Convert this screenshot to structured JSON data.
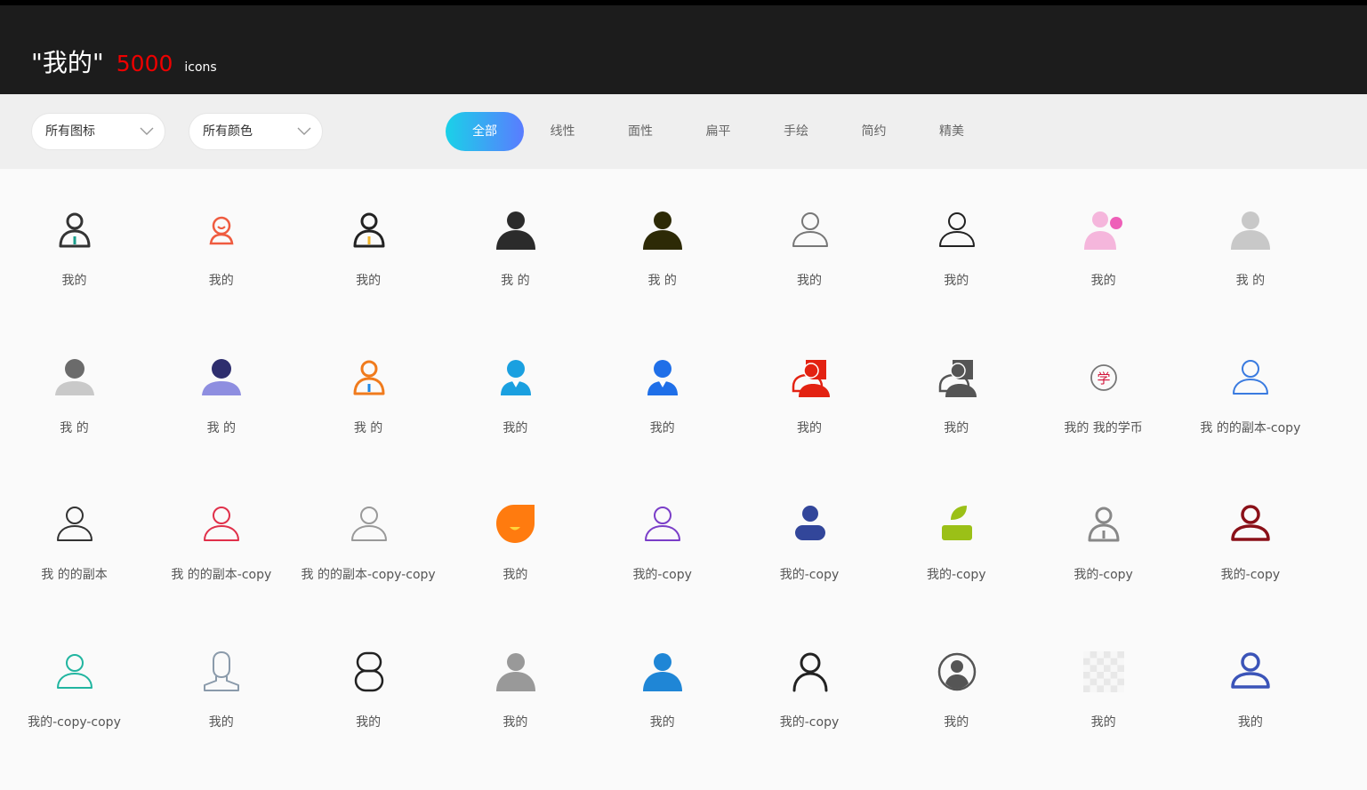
{
  "header": {
    "query": "\"我的\"",
    "count": "5000",
    "unit": "icons"
  },
  "filters": {
    "icon_select": "所有图标",
    "color_select": "所有颜色"
  },
  "tabs": [
    {
      "label": "全部",
      "active": true
    },
    {
      "label": "线性",
      "active": false
    },
    {
      "label": "面性",
      "active": false
    },
    {
      "label": "扁平",
      "active": false
    },
    {
      "label": "手绘",
      "active": false
    },
    {
      "label": "简约",
      "active": false
    },
    {
      "label": "精美",
      "active": false
    }
  ],
  "icons": [
    {
      "label": "我的",
      "icon": "user-outline-tie-icon",
      "color": "#333333",
      "accent": "#1a9e8c"
    },
    {
      "label": "我的",
      "icon": "user-smile-outline-icon",
      "color": "#ef5b3f",
      "accent": "#ef5b3f"
    },
    {
      "label": "我的",
      "icon": "user-outline-tie-icon",
      "color": "#222222",
      "accent": "#f0b429"
    },
    {
      "label": "我 的",
      "icon": "user-solid-icon",
      "color": "#2b2b2b",
      "accent": "#2b2b2b"
    },
    {
      "label": "我 的",
      "icon": "user-solid-icon",
      "color": "#2d2a06",
      "accent": "#2d2a06"
    },
    {
      "label": "我的",
      "icon": "user-thin-outline-icon",
      "color": "#777777",
      "accent": "#777777"
    },
    {
      "label": "我的",
      "icon": "user-thin-outline-icon",
      "color": "#222222",
      "accent": "#222222"
    },
    {
      "label": "我的",
      "icon": "user-pink-badge-icon",
      "color": "#f5b6dc",
      "accent": "#ee5fb8"
    },
    {
      "label": "我 的",
      "icon": "user-solid-icon",
      "color": "#c8c8c8",
      "accent": "#c8c8c8"
    },
    {
      "label": "我 的",
      "icon": "user-solid-two-tone-icon",
      "color": "#6b6b6b",
      "accent": "#c9c9c9"
    },
    {
      "label": "我 的",
      "icon": "user-solid-two-tone-icon",
      "color": "#2e2e6e",
      "accent": "#8e8ee0"
    },
    {
      "label": "我 的",
      "icon": "user-outline-tie-icon",
      "color": "#f07b1d",
      "accent": "#1e88e5"
    },
    {
      "label": "我的",
      "icon": "user-suit-icon",
      "color": "#1aa0e0",
      "accent": "#1aa0e0"
    },
    {
      "label": "我的",
      "icon": "user-suit-icon",
      "color": "#1f6fe8",
      "accent": "#1f6fe8"
    },
    {
      "label": "我的",
      "icon": "users-duo-icon",
      "color": "#e32212",
      "accent": "#e32212"
    },
    {
      "label": "我的",
      "icon": "users-duo-icon",
      "color": "#555555",
      "accent": "#555555"
    },
    {
      "label": "我的 我的学币",
      "icon": "coin-xue-icon",
      "color": "#777777",
      "accent": "#d2143a"
    },
    {
      "label": "我 的的副本-copy",
      "icon": "user-thin-outline-icon",
      "color": "#3a7be0",
      "accent": "#3a7be0"
    },
    {
      "label": "我 的的副本",
      "icon": "user-thin-outline-icon",
      "color": "#333333",
      "accent": "#333333"
    },
    {
      "label": "我 的的副本-copy",
      "icon": "user-thin-outline-icon",
      "color": "#e0304a",
      "accent": "#e0304a"
    },
    {
      "label": "我 的的副本-copy-copy",
      "icon": "user-thin-outline-icon",
      "color": "#999999",
      "accent": "#999999"
    },
    {
      "label": "我的",
      "icon": "smile-blob-icon",
      "color": "#ff7b0f",
      "accent": "#ffd43b"
    },
    {
      "label": "我的-copy",
      "icon": "user-thin-outline-icon",
      "color": "#7a3ec8",
      "accent": "#7a3ec8"
    },
    {
      "label": "我的-copy",
      "icon": "user-capsule-icon",
      "color": "#32469a",
      "accent": "#32469a"
    },
    {
      "label": "我的-copy",
      "icon": "user-leaf-icon",
      "color": "#9bc017",
      "accent": "#9bc017"
    },
    {
      "label": "我的-copy",
      "icon": "user-outline-tie-icon",
      "color": "#888888",
      "accent": "#888888"
    },
    {
      "label": "我的-copy",
      "icon": "user-bold-outline-icon",
      "color": "#8a1018",
      "accent": "#8a1018"
    },
    {
      "label": "我的-copy-copy",
      "icon": "user-thin-outline-icon",
      "color": "#21b5a0",
      "accent": "#21b5a0"
    },
    {
      "label": "我的",
      "icon": "user-bust-outline-icon",
      "color": "#8a9aaa",
      "accent": "#8a9aaa"
    },
    {
      "label": "我的",
      "icon": "figure-eight-outline-icon",
      "color": "#222222",
      "accent": "#222222"
    },
    {
      "label": "我的",
      "icon": "user-solid-icon",
      "color": "#999999",
      "accent": "#999999"
    },
    {
      "label": "我的",
      "icon": "user-solid-icon",
      "color": "#1f86d6",
      "accent": "#1f86d6"
    },
    {
      "label": "我的-copy",
      "icon": "user-line-icon",
      "color": "#222222",
      "accent": "#222222"
    },
    {
      "label": "我的",
      "icon": "user-circle-icon",
      "color": "#555555",
      "accent": "#555555"
    },
    {
      "label": "我的",
      "icon": "checkerboard-placeholder-icon",
      "color": "#e8e8e8",
      "accent": "#f7f7f7"
    },
    {
      "label": "我的",
      "icon": "user-bold-outline-icon",
      "color": "#3b54b8",
      "accent": "#3b54b8"
    }
  ]
}
